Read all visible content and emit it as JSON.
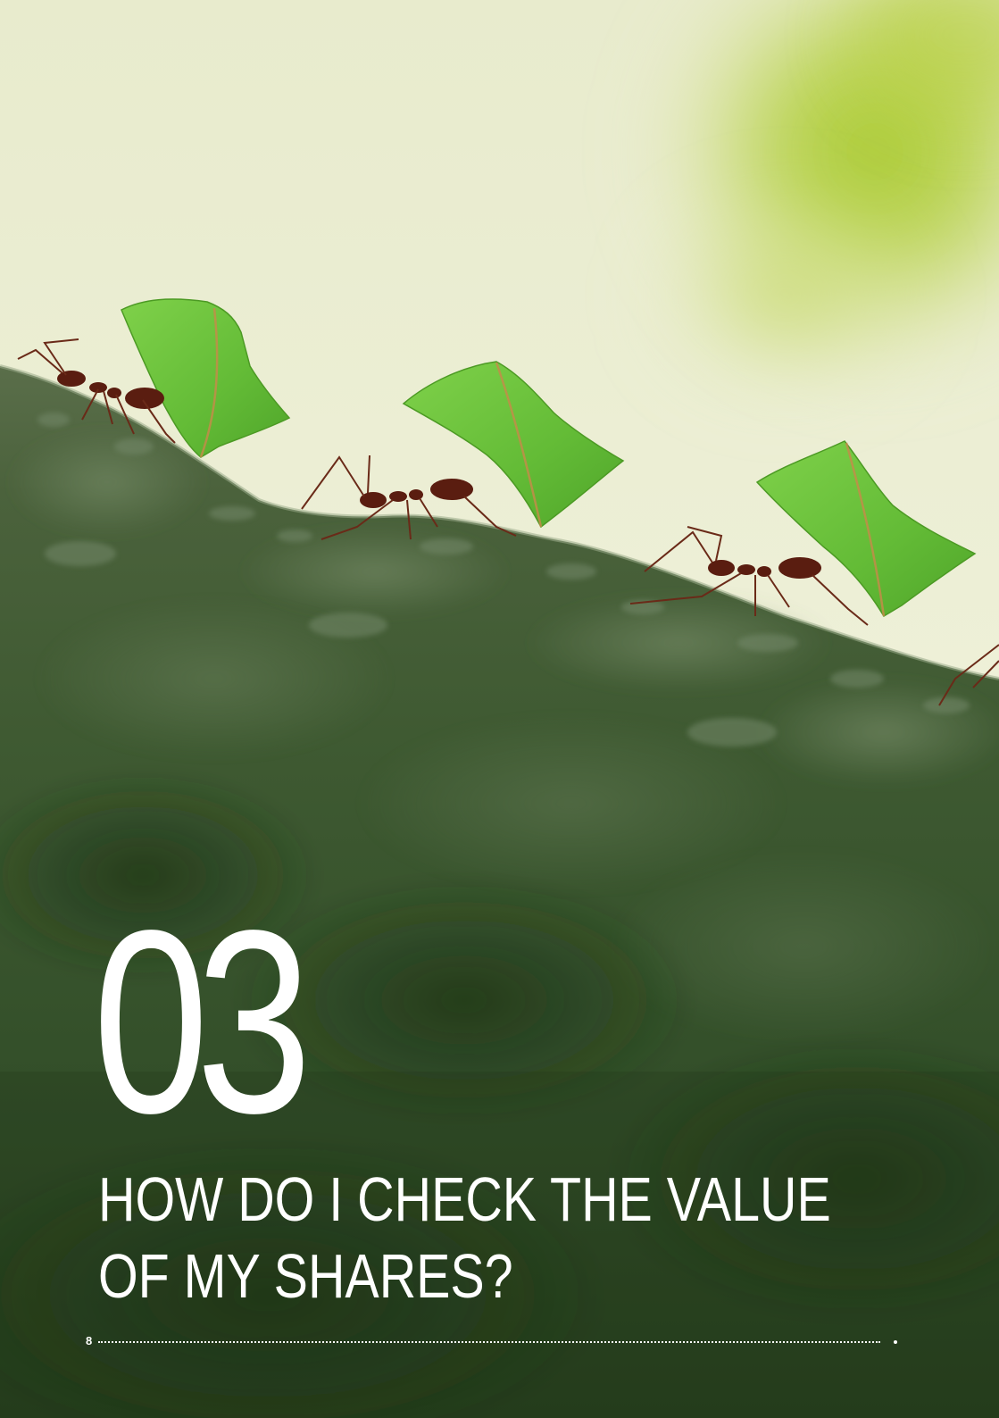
{
  "chapter": {
    "number": "03",
    "title_line_1": "HOW DO I CHECK THE VALUE",
    "title_line_2": "OF MY SHARES?"
  },
  "footer": {
    "page_number": "8"
  },
  "colors": {
    "text": "#ffffff",
    "sky_light": "#eef0d8",
    "foliage": "#a9c93a",
    "leaf": "#6cc23c",
    "ant": "#5a1d10",
    "branch_dark": "#2b4423"
  },
  "image": {
    "subject": "leaf-cutter ants carrying leaf pieces along a moss-covered branch"
  }
}
